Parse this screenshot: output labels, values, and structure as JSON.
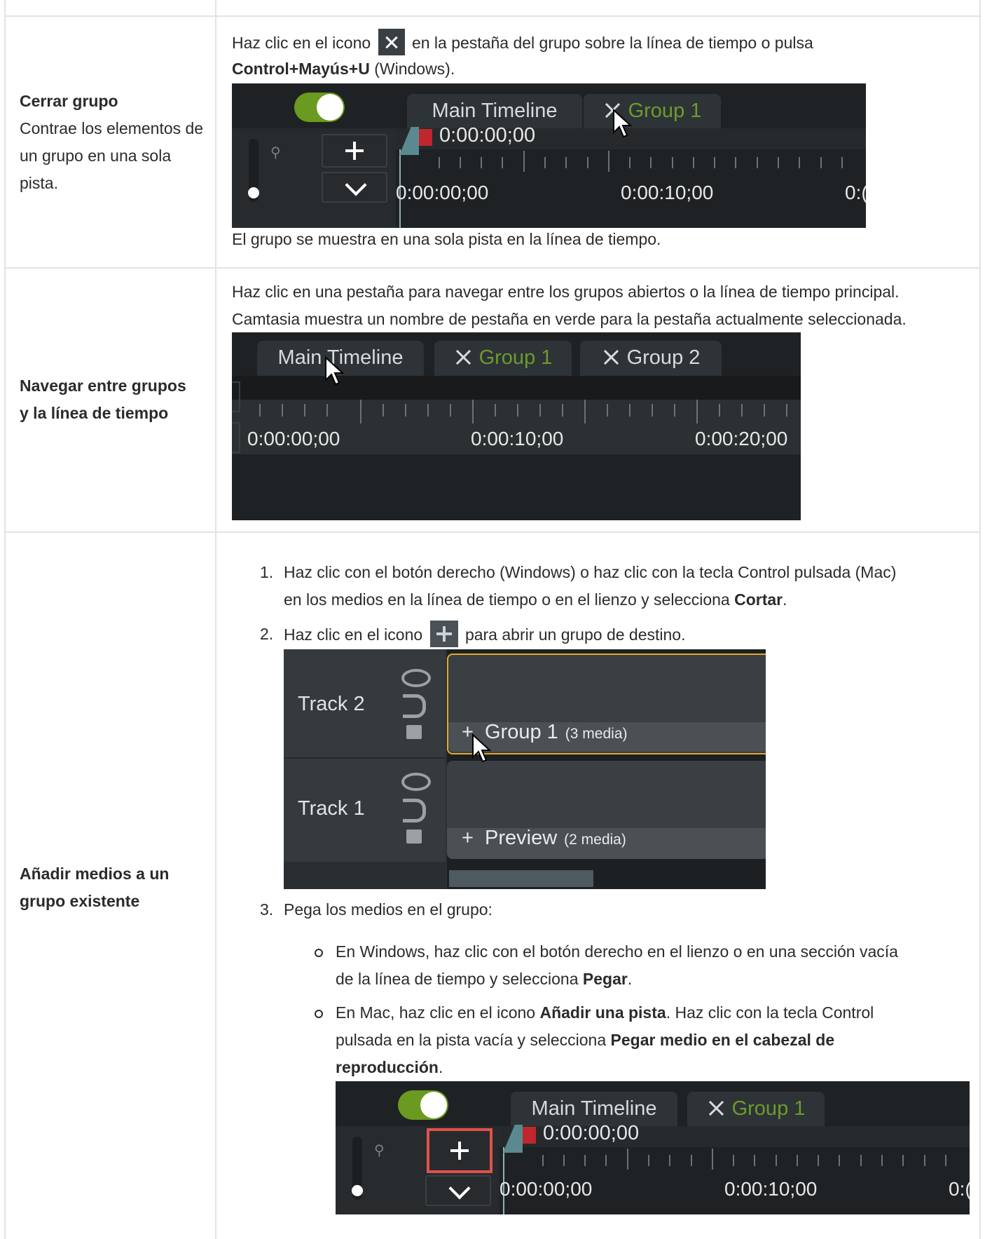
{
  "rows": [
    {
      "title": "Cerrar grupo",
      "description": "Contrae los elementos de un grupo en una sola pista.",
      "line1_a": "Haz clic en el icono",
      "line1_b": "en la pestaña del grupo sobre la línea de tiempo o pulsa",
      "shortcut": "Control+Mayús+U",
      "shortcut_suffix": " (Windows).",
      "screenshot": {
        "tab_main": "Main Timeline",
        "tab_group": "Group 1",
        "playhead_time": "0:00:00;00",
        "ticks": [
          "0:00:00;00",
          "0:00:10;00",
          "0:("
        ]
      },
      "after": "El grupo se muestra en una sola pista en la línea de tiempo."
    },
    {
      "title_line1": "Navegar entre grupos",
      "title_line2": "y la línea de tiempo",
      "line1": "Haz clic en una pestaña para navegar entre los grupos abiertos o la línea de tiempo principal.",
      "line2": "Camtasia muestra un nombre de pestaña en verde para la pestaña actualmente seleccionada.",
      "screenshot": {
        "tab_main": "Main Timeline",
        "tab_group1": "Group 1",
        "tab_group2": "Group 2",
        "ticks": [
          "0:00:00;00",
          "0:00:10;00",
          "0:00:20;00"
        ]
      }
    },
    {
      "title_line1": "Añadir medios a un",
      "title_line2": "grupo existente",
      "step1_num": "1.",
      "step1_a": "Haz clic con el botón derecho (Windows) o haz clic con la tecla Control pulsada (Mac)",
      "step1_b": "en los medios en la línea de tiempo o en el lienzo y selecciona ",
      "step1_bold": "Cortar",
      "step2_num": "2.",
      "step2_a": "Haz clic en el icono",
      "step2_b": "para abrir un grupo de destino.",
      "tracks_shot": {
        "track2": "Track 2",
        "track1": "Track 1",
        "group_name": "Group 1",
        "group_count": "(3 media)",
        "preview_name": "Preview",
        "preview_count": "(2 media)",
        "plus": "+"
      },
      "step3_num": "3.",
      "step3": "Pega los medios en el grupo:",
      "bullet1_a": "En Windows, haz clic con el botón derecho en el lienzo o en una sección vacía",
      "bullet1_b": "de la línea de tiempo y selecciona ",
      "bullet1_bold": "Pegar",
      "bullet2_a": "En Mac, haz clic en el icono ",
      "bullet2_bold1": "Añadir una pista",
      "bullet2_b": ". Haz clic con la tecla Control",
      "bullet2_c": "pulsada en la pista vacía y selecciona ",
      "bullet2_bold2": "Pegar medio en el cabezal de",
      "bullet2_bold3": "reproducción",
      "screenshot": {
        "tab_main": "Main Timeline",
        "tab_group": "Group 1",
        "playhead_time": "0:00:00;00",
        "ticks": [
          "0:00:00;00",
          "0:00:10;00",
          "0:("
        ]
      }
    }
  ],
  "colors": {
    "accent_green": "#6c9b2a",
    "highlight_red": "#e0524a",
    "group_border": "#e4a92a"
  },
  "punct": {
    "period": "."
  }
}
